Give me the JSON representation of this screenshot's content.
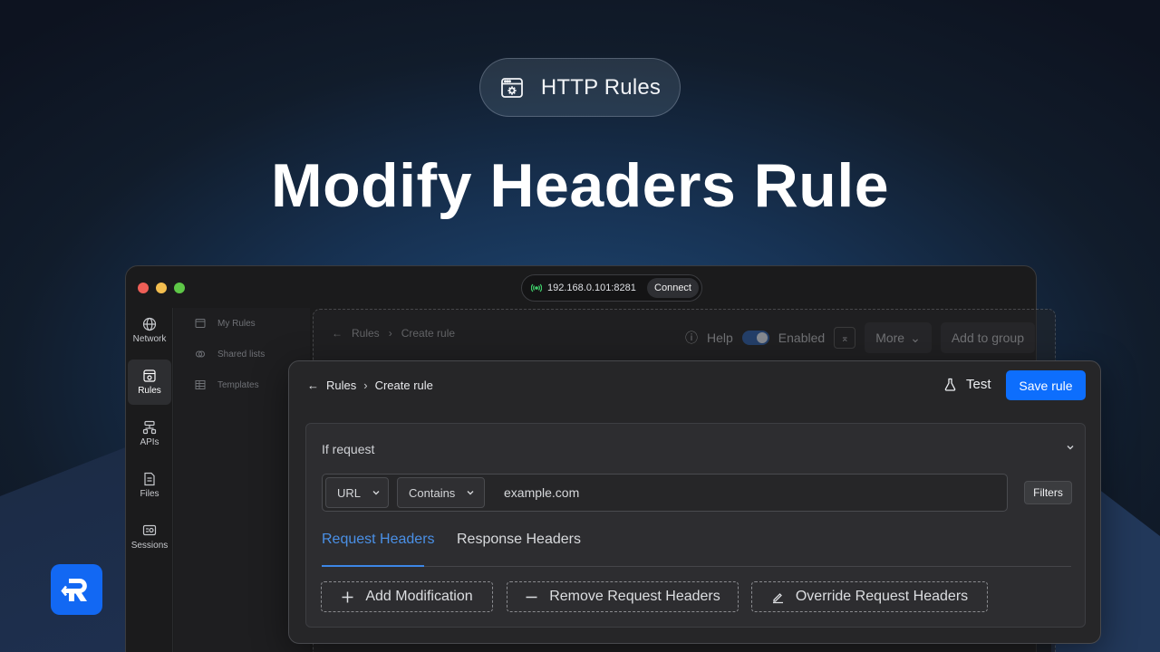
{
  "hero": {
    "pill_label": "HTTP Rules",
    "title": "Modify Headers Rule"
  },
  "window": {
    "connection": {
      "address": "192.168.0.101:8281",
      "connect_label": "Connect"
    },
    "sidebar": {
      "items": [
        {
          "label": "Network",
          "icon": "globe-icon"
        },
        {
          "label": "Rules",
          "icon": "rules-icon",
          "active": true
        },
        {
          "label": "APIs",
          "icon": "apis-icon"
        },
        {
          "label": "Files",
          "icon": "files-icon"
        },
        {
          "label": "Sessions",
          "icon": "sessions-icon"
        }
      ]
    },
    "subnav": {
      "items": [
        {
          "label": "My Rules"
        },
        {
          "label": "Shared lists"
        },
        {
          "label": "Templates"
        }
      ]
    },
    "ghost_panel": {
      "breadcrumb_root": "Rules",
      "breadcrumb_current": "Create rule",
      "help_label": "Help",
      "enabled_label": "Enabled",
      "more_label": "More",
      "add_group_label": "Add to group"
    }
  },
  "panel": {
    "breadcrumb_root": "Rules",
    "breadcrumb_current": "Create rule",
    "test_label": "Test",
    "save_label": "Save rule",
    "condition": {
      "title": "If request",
      "source_select": "URL",
      "operator_select": "Contains",
      "url_value": "example.com",
      "filters_label": "Filters"
    },
    "tabs": {
      "request": "Request Headers",
      "response": "Response Headers",
      "active": "request"
    },
    "actions": {
      "add": "Add Modification",
      "remove": "Remove Request Headers",
      "override": "Override Request Headers"
    }
  },
  "colors": {
    "accent": "#0d6efd",
    "tab_active": "#4a90e6",
    "connected": "#3fcf6a"
  }
}
